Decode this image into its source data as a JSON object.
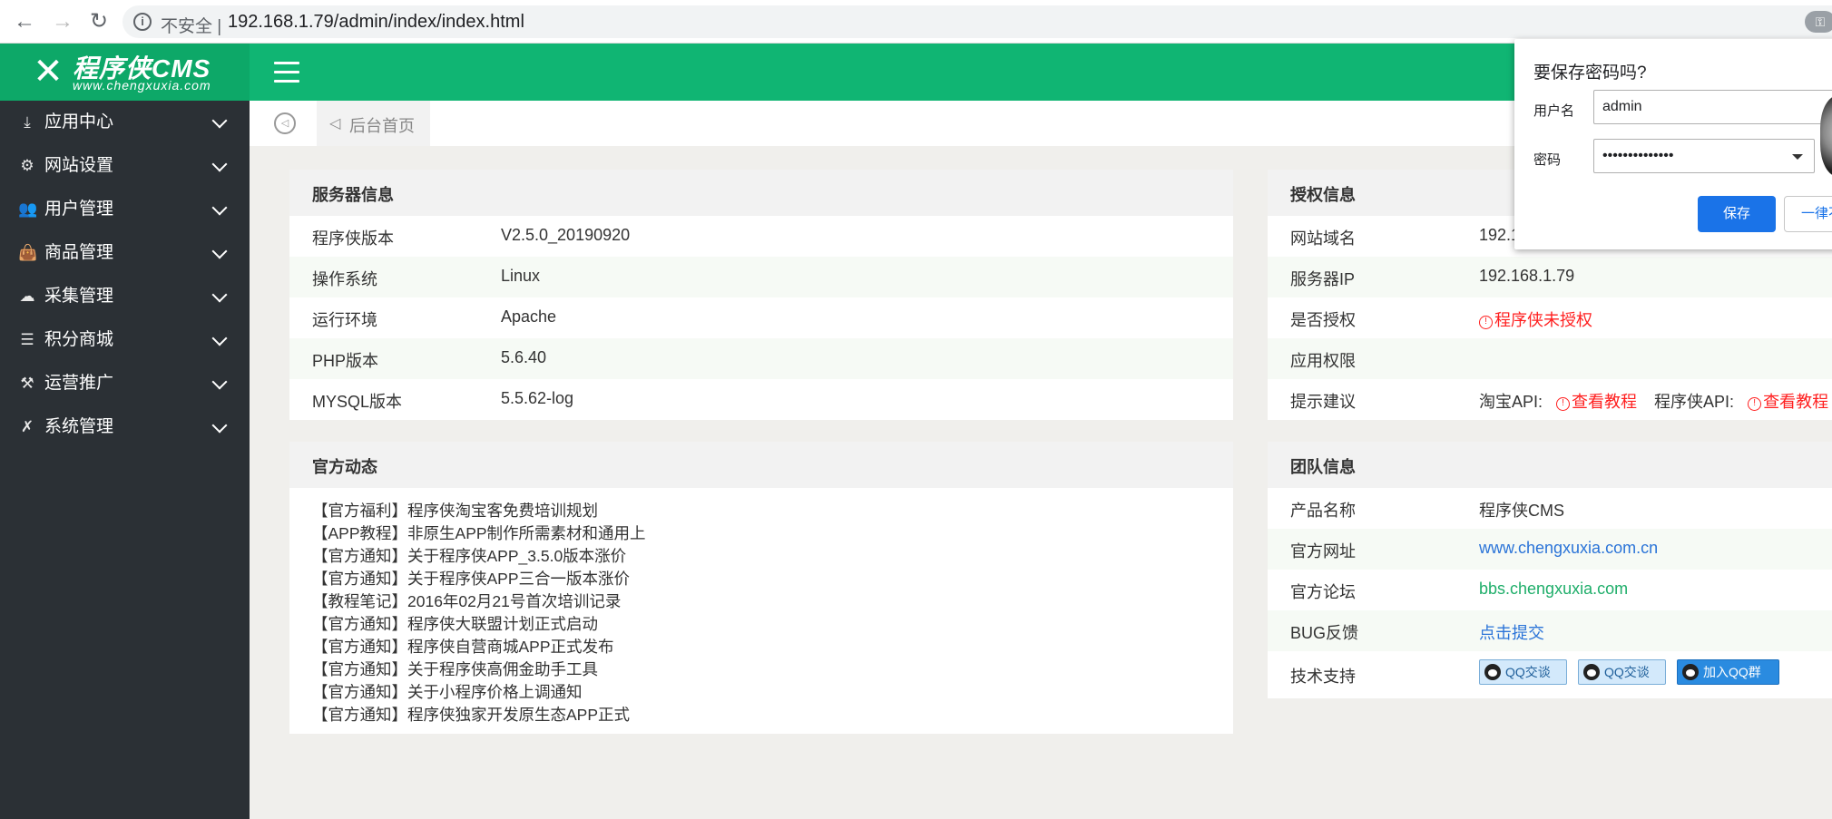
{
  "browser": {
    "insecure_label": "不安全 |",
    "url": "192.168.1.79/admin/index/index.html",
    "back": "←",
    "forward": "→",
    "reload": "↻"
  },
  "brand": {
    "logo_mark": "✕",
    "name": "程序侠CMS",
    "sub": "www.chengxuxia.com"
  },
  "sidebar": {
    "items": [
      {
        "label": "应用中心",
        "icon": "⤓"
      },
      {
        "label": "网站设置",
        "icon": "⚙"
      },
      {
        "label": "用户管理",
        "icon": "👥"
      },
      {
        "label": "商品管理",
        "icon": "👜"
      },
      {
        "label": "采集管理",
        "icon": "☁"
      },
      {
        "label": "积分商城",
        "icon": "☰"
      },
      {
        "label": "运营推广",
        "icon": "⚒"
      },
      {
        "label": "系统管理",
        "icon": "✗"
      }
    ]
  },
  "tabs": {
    "home_icon": "◁",
    "home_label": "后台首页"
  },
  "server": {
    "title": "服务器信息",
    "rows": [
      {
        "key": "程序侠版本",
        "value": "V2.5.0_20190920"
      },
      {
        "key": "操作系统",
        "value": "Linux"
      },
      {
        "key": "运行环境",
        "value": "Apache"
      },
      {
        "key": "PHP版本",
        "value": "5.6.40"
      },
      {
        "key": "MYSQL版本",
        "value": "5.5.62-log"
      }
    ]
  },
  "news": {
    "title": "官方动态",
    "items": [
      "【官方福利】程序侠淘宝客免费培训规划",
      "【APP教程】非原生APP制作所需素材和通用上",
      "【官方通知】关于程序侠APP_3.5.0版本涨价",
      "【官方通知】关于程序侠APP三合一版本涨价",
      "【教程笔记】2016年02月21号首次培训记录",
      "【官方通知】程序侠大联盟计划正式启动",
      "【官方通知】程序侠自营商城APP正式发布",
      "【官方通知】关于程序侠高佣金助手工具",
      "【官方通知】关于小程序价格上调通知",
      "【官方通知】程序侠独家开发原生态APP正式"
    ]
  },
  "license": {
    "title": "授权信息",
    "domain_key": "网站域名",
    "domain_value": "192.1",
    "ip_key": "服务器IP",
    "ip_value": "192.168.1.79",
    "auth_key": "是否授权",
    "auth_icon": "!",
    "auth_value": "程序侠未授权",
    "perm_key": "应用权限",
    "perm_value": "",
    "tip_key": "提示建议",
    "taobao_label": "淘宝API:",
    "taobao_link": "查看教程",
    "cxx_label": "程序侠API:",
    "cxx_link": "查看教程"
  },
  "team": {
    "title": "团队信息",
    "product_key": "产品名称",
    "product_value": "程序侠CMS",
    "site_key": "官方网址",
    "site_value": "www.chengxuxia.com.cn",
    "forum_key": "官方论坛",
    "forum_value": "bbs.chengxuxia.com",
    "bug_key": "BUG反馈",
    "bug_value": "点击提交",
    "support_key": "技术支持",
    "qq1": "QQ交谈",
    "qq2": "QQ交谈",
    "qq_group": "加入QQ群"
  },
  "password_popup": {
    "title": "要保存密码吗?",
    "username_label": "用户名",
    "username_value": "admin",
    "password_label": "密码",
    "password_value": "••••••••••••••",
    "save_label": "保存",
    "never_label": "一律不"
  },
  "colors": {
    "header_green": "#10b573",
    "sidebar_dark": "#2b3035",
    "link_blue": "#2b74d8",
    "link_green": "#1fae6a",
    "alert_red": "#ff1f1f",
    "button_blue": "#1a73e8"
  }
}
